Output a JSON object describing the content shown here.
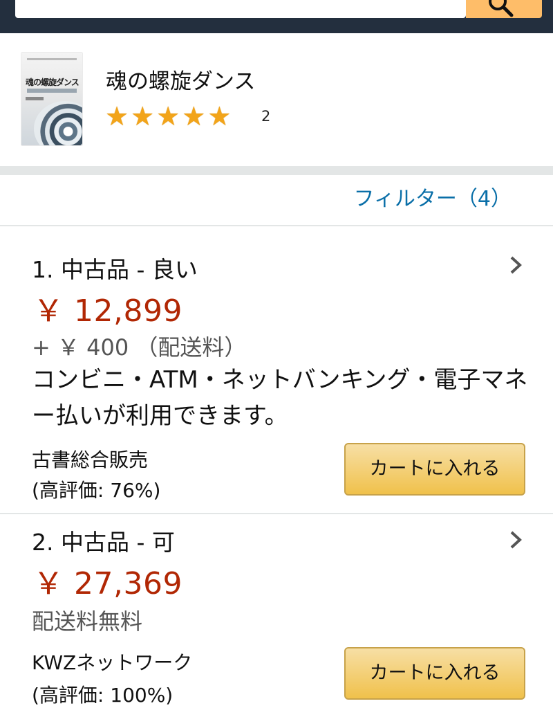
{
  "search": {
    "icon": "search-icon"
  },
  "product": {
    "title": "魂の螺旋ダンス",
    "rating_stars": 5,
    "rating_count": "2",
    "cover_icon": "book-cover-image"
  },
  "filter": {
    "label": "フィルター（4）"
  },
  "offers": [
    {
      "heading": "1. 中古品 - 良い",
      "price": "￥ 12,899",
      "shipping": "+ ￥ 400 （配送料）",
      "payment_note": "コンビニ・ATM・ネットバンキング・電子マネー払いが利用できます。",
      "seller": "古書総合販売",
      "seller_rating": "(高評価: 76%)",
      "cart_label": "カートに入れる"
    },
    {
      "heading": "2. 中古品 - 可",
      "price": "￥ 27,369",
      "shipping": "配送料無料",
      "seller": "KWZネットワーク",
      "seller_rating": "(高評価: 100%)",
      "cart_label": "カートに入れる"
    }
  ],
  "colors": {
    "header_bg": "#232f3e",
    "search_button": "#febd69",
    "price": "#b12704",
    "link": "#0a6fa8",
    "star": "#f2a41a",
    "cart_button": "#f0c14b"
  }
}
